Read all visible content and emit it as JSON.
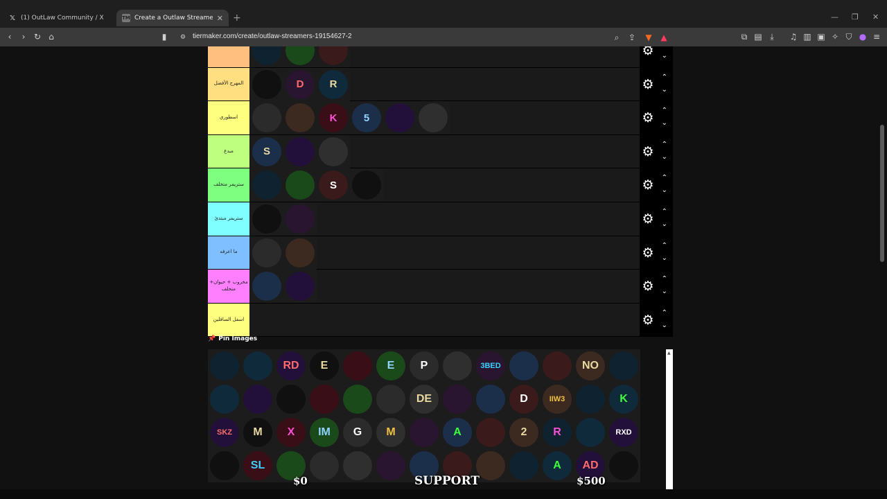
{
  "browser": {
    "tabs": [
      {
        "title": "(1) OutLaw Community / X",
        "active": false
      },
      {
        "title": "Create a Outlaw Streamers Tier l",
        "active": true
      }
    ],
    "url": "tiermaker.com/create/outlaw-streamers-19154627-2"
  },
  "tiers": [
    {
      "label": "",
      "color": "#ffbf7f",
      "items": [
        "",
        "",
        ""
      ]
    },
    {
      "label": "المهرج الأفضل",
      "color": "#ffdf7f",
      "items": [
        "",
        "D",
        "R"
      ]
    },
    {
      "label": "اسطوري",
      "color": "#ffff7f",
      "items": [
        "",
        "",
        "K",
        "5",
        "",
        ""
      ]
    },
    {
      "label": "مبدع",
      "color": "#bfff7f",
      "items": [
        "S",
        "",
        ""
      ]
    },
    {
      "label": "ستريمر متخلف",
      "color": "#7fff7f",
      "items": [
        "",
        "",
        "S",
        ""
      ]
    },
    {
      "label": "ستريمر مبتدئ",
      "color": "#7fffff",
      "items": [
        "",
        ""
      ]
    },
    {
      "label": "ما اعرفه",
      "color": "#7fbfff",
      "items": [
        "",
        ""
      ]
    },
    {
      "label": "مخروب + حيوان+ متخلف",
      "color": "#ff7fff",
      "items": [
        "",
        ""
      ]
    },
    {
      "label": "اسفل السافلين",
      "color": "#ffff7f",
      "items": []
    }
  ],
  "pin_images_label": "Pin Images",
  "pool_items": [
    "",
    "",
    "RD",
    "E",
    "",
    "E",
    "P",
    "",
    "3BED",
    "",
    "",
    "NO",
    "",
    "",
    "",
    "",
    "",
    "",
    "",
    "DE",
    "",
    "",
    "D",
    "IIW3",
    "",
    "K",
    "SKZ",
    "M",
    "X",
    "IM",
    "G",
    "M",
    "",
    "A",
    "",
    "2",
    "R",
    "",
    "RXD",
    "",
    "SL",
    "",
    "",
    "",
    "",
    "",
    "",
    "",
    "",
    "A",
    "AD",
    ""
  ],
  "video_overlay": {
    "left": "$0",
    "center": "SUPPORT",
    "right": "$500"
  }
}
